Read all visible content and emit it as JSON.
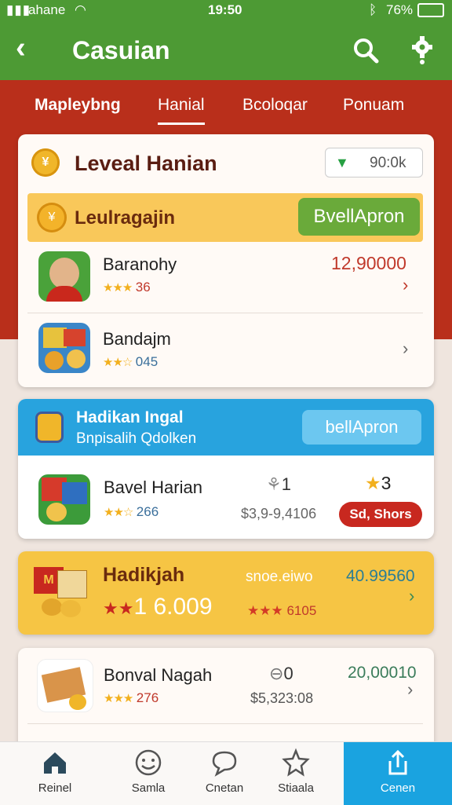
{
  "status": {
    "carrier": "ahane",
    "time": "19:50",
    "battery": "76%"
  },
  "appbar": {
    "title": "Casuian"
  },
  "tabs": [
    "Mapleybng",
    "Hanial",
    "Bcoloqar",
    "Ponuam"
  ],
  "section1": {
    "title": "Leveal Hanian",
    "badge": "90:0k",
    "banner": {
      "label": "Leulragajin",
      "button": "BvellApron"
    },
    "rows": [
      {
        "name": "Baranohy",
        "rating": "36",
        "value": "12,90000"
      },
      {
        "name": "Bandajm",
        "rating": "045",
        "value": ""
      }
    ]
  },
  "section2": {
    "title": "Hadikan Ingal",
    "subtitle": "Bnpisalih Qdolken",
    "button": "bellApron",
    "row": {
      "name": "Bavel Harian",
      "rating": "266",
      "count1": "1",
      "count2": "3",
      "price": "$3,9-9,4106",
      "pill": "Sd, Shors"
    }
  },
  "section3": {
    "title": "Hadikjah",
    "big": "1 6.009",
    "mid": "snoe.eiwo",
    "rating": "6105",
    "value": "40.99560"
  },
  "section4": {
    "name": "Bonval Nagah",
    "rating": "276",
    "count": "0",
    "price": "$5,323:08",
    "value": "20,00010"
  },
  "nav": [
    {
      "label": "Reinel",
      "icon": "home-icon"
    },
    {
      "label": "Samla",
      "icon": "smile-icon"
    },
    {
      "label": "Cnetan",
      "icon": "chat-icon"
    },
    {
      "label": "Stiaala",
      "icon": "star-icon"
    },
    {
      "label": "Cenen",
      "icon": "share-icon"
    }
  ],
  "colors": {
    "green": "#4d9a34",
    "red": "#b92f1b",
    "blue": "#28a3de",
    "yellow": "#f6c544"
  }
}
